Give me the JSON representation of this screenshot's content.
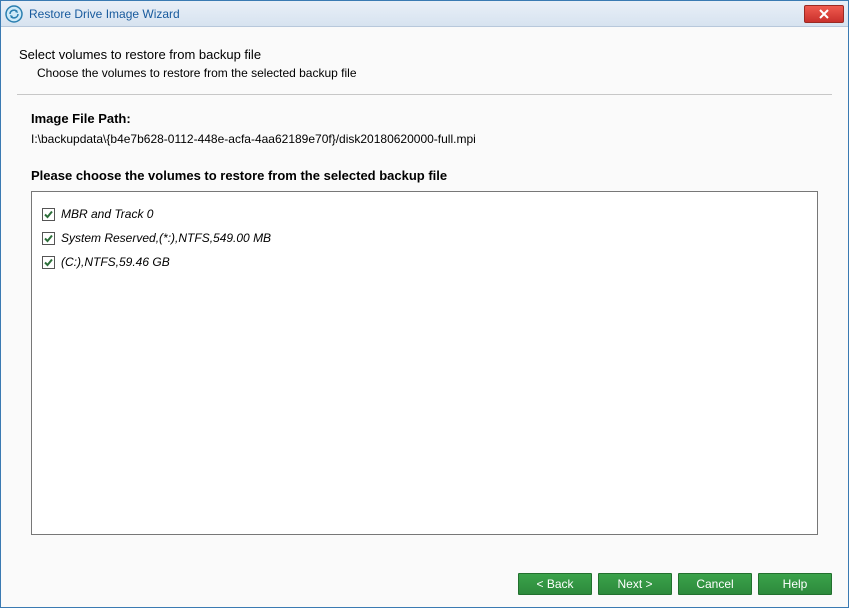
{
  "window": {
    "title": "Restore Drive Image Wizard"
  },
  "header": {
    "title": "Select volumes to restore from backup file",
    "subtitle": "Choose the volumes to restore from the selected backup file"
  },
  "imagePath": {
    "label": "Image File Path:",
    "value": "I:\\backupdata\\{b4e7b628-0112-448e-acfa-4aa62189e70f}/disk20180620000-full.mpi"
  },
  "volumes": {
    "prompt": "Please choose the volumes to restore from the selected backup file",
    "items": [
      {
        "label": "MBR and Track 0",
        "checked": true
      },
      {
        "label": "System Reserved,(*:),NTFS,549.00 MB",
        "checked": true
      },
      {
        "label": "(C:),NTFS,59.46 GB",
        "checked": true
      }
    ]
  },
  "buttons": {
    "back": "< Back",
    "next": "Next >",
    "cancel": "Cancel",
    "help": "Help"
  }
}
